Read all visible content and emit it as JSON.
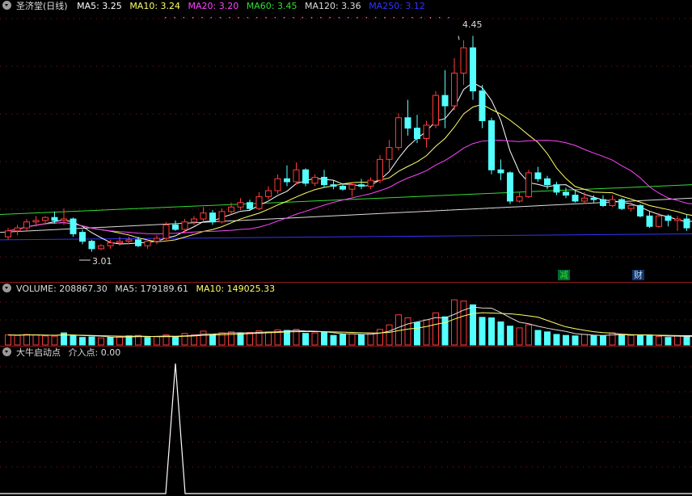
{
  "main_legend": {
    "title": "圣济堂(日线)",
    "items": [
      {
        "label": "MA5: 3.25",
        "color": "#ffffff"
      },
      {
        "label": "MA10: 3.24",
        "color": "#ffff66"
      },
      {
        "label": "MA20: 3.20",
        "color": "#ff44ff"
      },
      {
        "label": "MA60: 3.45",
        "color": "#33dd33"
      },
      {
        "label": "MA120: 3.36",
        "color": "#dddddd"
      },
      {
        "label": "MA250: 3.12",
        "color": "#3333ff"
      }
    ]
  },
  "volume_legend": {
    "items": [
      {
        "label": "VOLUME: 208867.30",
        "color": "#dddddd"
      },
      {
        "label": "MA5: 179189.61",
        "color": "#dddddd"
      },
      {
        "label": "MA10: 149025.33",
        "color": "#ffff66"
      }
    ]
  },
  "signal_legend": {
    "items": [
      {
        "label": "大牛启动点",
        "color": "#dddddd"
      },
      {
        "label": "介入点: 0.00",
        "color": "#dddddd"
      }
    ]
  },
  "annotations": {
    "high_label": "4.45",
    "low_label": "3.01",
    "marker_reduce": "减",
    "marker_finance": "财"
  },
  "colors": {
    "up": "#ff3b3b",
    "down": "#54ffff",
    "grid": "#8b1a1a"
  },
  "chart_data": {
    "type": "candlestick",
    "ylim": [
      2.9,
      4.55
    ],
    "candles": [
      {
        "o": 3.1,
        "h": 3.16,
        "l": 3.08,
        "c": 3.14
      },
      {
        "o": 3.14,
        "h": 3.18,
        "l": 3.11,
        "c": 3.16
      },
      {
        "o": 3.16,
        "h": 3.22,
        "l": 3.14,
        "c": 3.2
      },
      {
        "o": 3.2,
        "h": 3.24,
        "l": 3.17,
        "c": 3.21
      },
      {
        "o": 3.21,
        "h": 3.24,
        "l": 3.18,
        "c": 3.23
      },
      {
        "o": 3.23,
        "h": 3.27,
        "l": 3.19,
        "c": 3.21
      },
      {
        "o": 3.21,
        "h": 3.29,
        "l": 3.18,
        "c": 3.22
      },
      {
        "o": 3.22,
        "h": 3.23,
        "l": 3.1,
        "c": 3.12
      },
      {
        "o": 3.13,
        "h": 3.15,
        "l": 3.05,
        "c": 3.07
      },
      {
        "o": 3.07,
        "h": 3.08,
        "l": 3.0,
        "c": 3.02
      },
      {
        "o": 3.02,
        "h": 3.05,
        "l": 3.01,
        "c": 3.04
      },
      {
        "o": 3.04,
        "h": 3.08,
        "l": 3.02,
        "c": 3.06
      },
      {
        "o": 3.06,
        "h": 3.1,
        "l": 3.04,
        "c": 3.07
      },
      {
        "o": 3.07,
        "h": 3.1,
        "l": 3.05,
        "c": 3.08
      },
      {
        "o": 3.08,
        "h": 3.1,
        "l": 3.03,
        "c": 3.04
      },
      {
        "o": 3.04,
        "h": 3.08,
        "l": 3.02,
        "c": 3.07
      },
      {
        "o": 3.07,
        "h": 3.11,
        "l": 3.05,
        "c": 3.09
      },
      {
        "o": 3.09,
        "h": 3.2,
        "l": 3.07,
        "c": 3.18
      },
      {
        "o": 3.18,
        "h": 3.21,
        "l": 3.14,
        "c": 3.15
      },
      {
        "o": 3.15,
        "h": 3.22,
        "l": 3.13,
        "c": 3.2
      },
      {
        "o": 3.2,
        "h": 3.24,
        "l": 3.18,
        "c": 3.22
      },
      {
        "o": 3.22,
        "h": 3.3,
        "l": 3.2,
        "c": 3.26
      },
      {
        "o": 3.26,
        "h": 3.28,
        "l": 3.18,
        "c": 3.2
      },
      {
        "o": 3.2,
        "h": 3.29,
        "l": 3.19,
        "c": 3.27
      },
      {
        "o": 3.27,
        "h": 3.33,
        "l": 3.25,
        "c": 3.3
      },
      {
        "o": 3.3,
        "h": 3.36,
        "l": 3.28,
        "c": 3.33
      },
      {
        "o": 3.33,
        "h": 3.35,
        "l": 3.28,
        "c": 3.29
      },
      {
        "o": 3.29,
        "h": 3.4,
        "l": 3.28,
        "c": 3.37
      },
      {
        "o": 3.37,
        "h": 3.44,
        "l": 3.35,
        "c": 3.41
      },
      {
        "o": 3.41,
        "h": 3.52,
        "l": 3.39,
        "c": 3.49
      },
      {
        "o": 3.49,
        "h": 3.58,
        "l": 3.44,
        "c": 3.47
      },
      {
        "o": 3.47,
        "h": 3.6,
        "l": 3.45,
        "c": 3.55
      },
      {
        "o": 3.55,
        "h": 3.56,
        "l": 3.44,
        "c": 3.46
      },
      {
        "o": 3.46,
        "h": 3.52,
        "l": 3.44,
        "c": 3.5
      },
      {
        "o": 3.5,
        "h": 3.55,
        "l": 3.43,
        "c": 3.45
      },
      {
        "o": 3.45,
        "h": 3.48,
        "l": 3.42,
        "c": 3.44
      },
      {
        "o": 3.44,
        "h": 3.46,
        "l": 3.41,
        "c": 3.42
      },
      {
        "o": 3.42,
        "h": 3.47,
        "l": 3.37,
        "c": 3.45
      },
      {
        "o": 3.45,
        "h": 3.49,
        "l": 3.42,
        "c": 3.44
      },
      {
        "o": 3.44,
        "h": 3.5,
        "l": 3.42,
        "c": 3.48
      },
      {
        "o": 3.48,
        "h": 3.65,
        "l": 3.46,
        "c": 3.62
      },
      {
        "o": 3.62,
        "h": 3.75,
        "l": 3.55,
        "c": 3.7
      },
      {
        "o": 3.7,
        "h": 3.93,
        "l": 3.68,
        "c": 3.9
      },
      {
        "o": 3.9,
        "h": 4.02,
        "l": 3.78,
        "c": 3.83
      },
      {
        "o": 3.83,
        "h": 3.92,
        "l": 3.73,
        "c": 3.76
      },
      {
        "o": 3.76,
        "h": 3.88,
        "l": 3.7,
        "c": 3.85
      },
      {
        "o": 3.85,
        "h": 4.08,
        "l": 3.83,
        "c": 4.05
      },
      {
        "o": 4.05,
        "h": 4.22,
        "l": 3.83,
        "c": 3.98
      },
      {
        "o": 3.98,
        "h": 4.3,
        "l": 3.95,
        "c": 4.2
      },
      {
        "o": 4.2,
        "h": 4.42,
        "l": 4.12,
        "c": 4.37
      },
      {
        "o": 4.37,
        "h": 4.45,
        "l": 4.02,
        "c": 4.08
      },
      {
        "o": 4.08,
        "h": 4.12,
        "l": 3.83,
        "c": 3.88
      },
      {
        "o": 3.88,
        "h": 3.9,
        "l": 3.52,
        "c": 3.55
      },
      {
        "o": 3.55,
        "h": 3.62,
        "l": 3.48,
        "c": 3.53
      },
      {
        "o": 3.53,
        "h": 3.54,
        "l": 3.32,
        "c": 3.34
      },
      {
        "o": 3.34,
        "h": 3.4,
        "l": 3.33,
        "c": 3.37
      },
      {
        "o": 3.37,
        "h": 3.55,
        "l": 3.36,
        "c": 3.53
      },
      {
        "o": 3.53,
        "h": 3.57,
        "l": 3.47,
        "c": 3.49
      },
      {
        "o": 3.49,
        "h": 3.51,
        "l": 3.42,
        "c": 3.45
      },
      {
        "o": 3.45,
        "h": 3.47,
        "l": 3.38,
        "c": 3.4
      },
      {
        "o": 3.4,
        "h": 3.43,
        "l": 3.36,
        "c": 3.38
      },
      {
        "o": 3.38,
        "h": 3.41,
        "l": 3.33,
        "c": 3.34
      },
      {
        "o": 3.34,
        "h": 3.4,
        "l": 3.32,
        "c": 3.36
      },
      {
        "o": 3.36,
        "h": 3.38,
        "l": 3.33,
        "c": 3.35
      },
      {
        "o": 3.35,
        "h": 3.38,
        "l": 3.3,
        "c": 3.31
      },
      {
        "o": 3.31,
        "h": 3.38,
        "l": 3.3,
        "c": 3.35
      },
      {
        "o": 3.35,
        "h": 3.36,
        "l": 3.28,
        "c": 3.29
      },
      {
        "o": 3.29,
        "h": 3.33,
        "l": 3.27,
        "c": 3.31
      },
      {
        "o": 3.31,
        "h": 3.32,
        "l": 3.23,
        "c": 3.24
      },
      {
        "o": 3.24,
        "h": 3.27,
        "l": 3.16,
        "c": 3.17
      },
      {
        "o": 3.17,
        "h": 3.26,
        "l": 3.16,
        "c": 3.24
      },
      {
        "o": 3.24,
        "h": 3.25,
        "l": 3.17,
        "c": 3.21
      },
      {
        "o": 3.21,
        "h": 3.24,
        "l": 3.14,
        "c": 3.22
      },
      {
        "o": 3.22,
        "h": 3.25,
        "l": 3.14,
        "c": 3.16
      },
      {
        "o": 3.16,
        "h": 3.22,
        "l": 3.15,
        "c": 3.21
      }
    ],
    "ma_lines": [
      {
        "name": "MA250",
        "color": "#3333ff",
        "values": [
          3.08,
          3.12
        ]
      },
      {
        "name": "MA120",
        "color": "#dddddd",
        "values": [
          3.13,
          3.36
        ]
      },
      {
        "name": "MA60",
        "color": "#33dd33",
        "values": [
          3.25,
          3.45
        ]
      }
    ],
    "volume": [
      [
        40,
        1
      ],
      [
        38,
        1
      ],
      [
        42,
        1
      ],
      [
        40,
        1
      ],
      [
        36,
        1
      ],
      [
        35,
        1
      ],
      [
        48,
        0
      ],
      [
        38,
        0
      ],
      [
        30,
        0
      ],
      [
        32,
        0
      ],
      [
        28,
        1
      ],
      [
        30,
        0
      ],
      [
        34,
        1
      ],
      [
        36,
        0
      ],
      [
        38,
        1
      ],
      [
        30,
        0
      ],
      [
        34,
        1
      ],
      [
        40,
        1
      ],
      [
        32,
        0
      ],
      [
        46,
        1
      ],
      [
        40,
        1
      ],
      [
        55,
        1
      ],
      [
        42,
        0
      ],
      [
        48,
        1
      ],
      [
        52,
        1
      ],
      [
        46,
        0
      ],
      [
        50,
        1
      ],
      [
        56,
        1
      ],
      [
        52,
        1
      ],
      [
        60,
        1
      ],
      [
        58,
        0
      ],
      [
        62,
        1
      ],
      [
        46,
        0
      ],
      [
        48,
        1
      ],
      [
        50,
        0
      ],
      [
        38,
        0
      ],
      [
        42,
        0
      ],
      [
        44,
        1
      ],
      [
        40,
        0
      ],
      [
        48,
        1
      ],
      [
        62,
        1
      ],
      [
        80,
        1
      ],
      [
        120,
        1
      ],
      [
        108,
        1
      ],
      [
        90,
        0
      ],
      [
        100,
        1
      ],
      [
        128,
        1
      ],
      [
        112,
        0
      ],
      [
        180,
        1
      ],
      [
        175,
        1
      ],
      [
        160,
        0
      ],
      [
        110,
        0
      ],
      [
        108,
        0
      ],
      [
        92,
        0
      ],
      [
        75,
        0
      ],
      [
        68,
        1
      ],
      [
        80,
        1
      ],
      [
        58,
        0
      ],
      [
        52,
        0
      ],
      [
        42,
        0
      ],
      [
        38,
        0
      ],
      [
        36,
        0
      ],
      [
        42,
        1
      ],
      [
        38,
        0
      ],
      [
        36,
        0
      ],
      [
        48,
        1
      ],
      [
        40,
        0
      ],
      [
        38,
        1
      ],
      [
        40,
        0
      ],
      [
        36,
        0
      ],
      [
        34,
        1
      ],
      [
        30,
        0
      ],
      [
        36,
        1
      ],
      [
        34,
        0
      ],
      [
        32,
        1
      ]
    ],
    "signal": {
      "peak_index": 18,
      "peak_value": 1
    }
  }
}
